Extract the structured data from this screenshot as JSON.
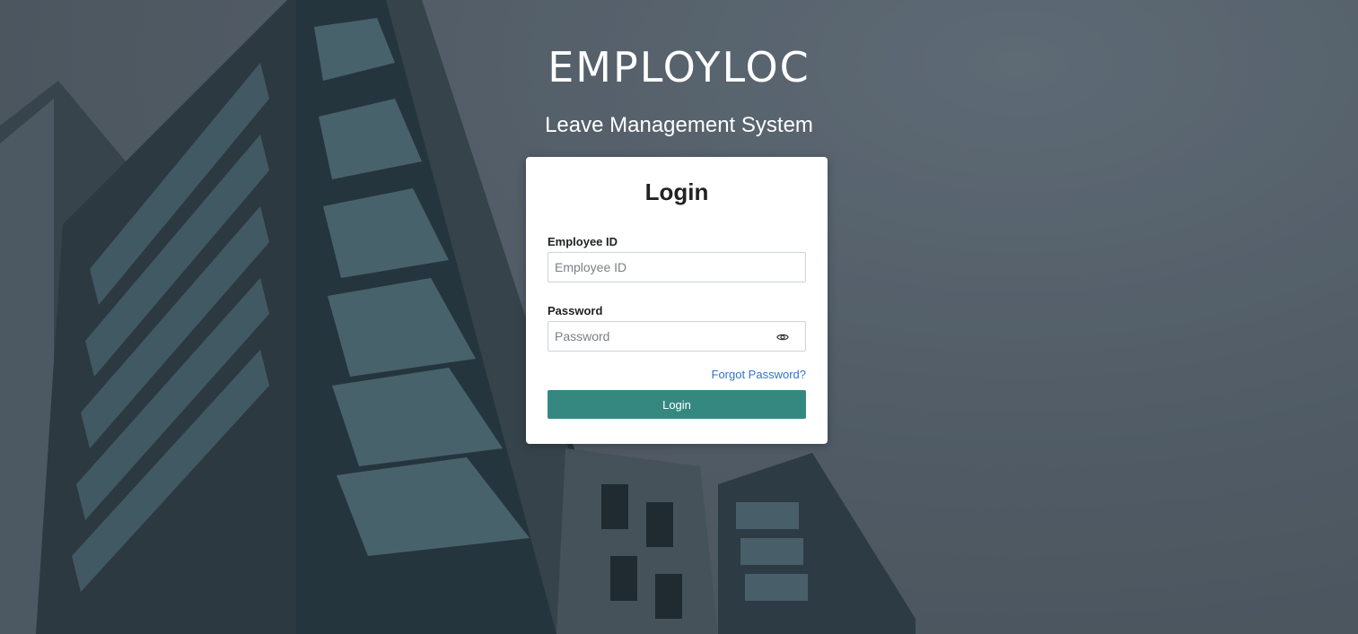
{
  "brand": {
    "logo_text": "EMPLOYLOC",
    "subtitle": "Leave Management System"
  },
  "login_form": {
    "title": "Login",
    "employee_id": {
      "label": "Employee ID",
      "placeholder": "Employee ID",
      "value": ""
    },
    "password": {
      "label": "Password",
      "placeholder": "Password",
      "value": "",
      "toggle_icon": "eye-icon"
    },
    "forgot_password_link": "Forgot Password?",
    "submit_label": "Login"
  },
  "colors": {
    "primary_button": "#358880",
    "link": "#2f74c9",
    "card_background": "#ffffff",
    "text_on_background": "#ffffff"
  }
}
